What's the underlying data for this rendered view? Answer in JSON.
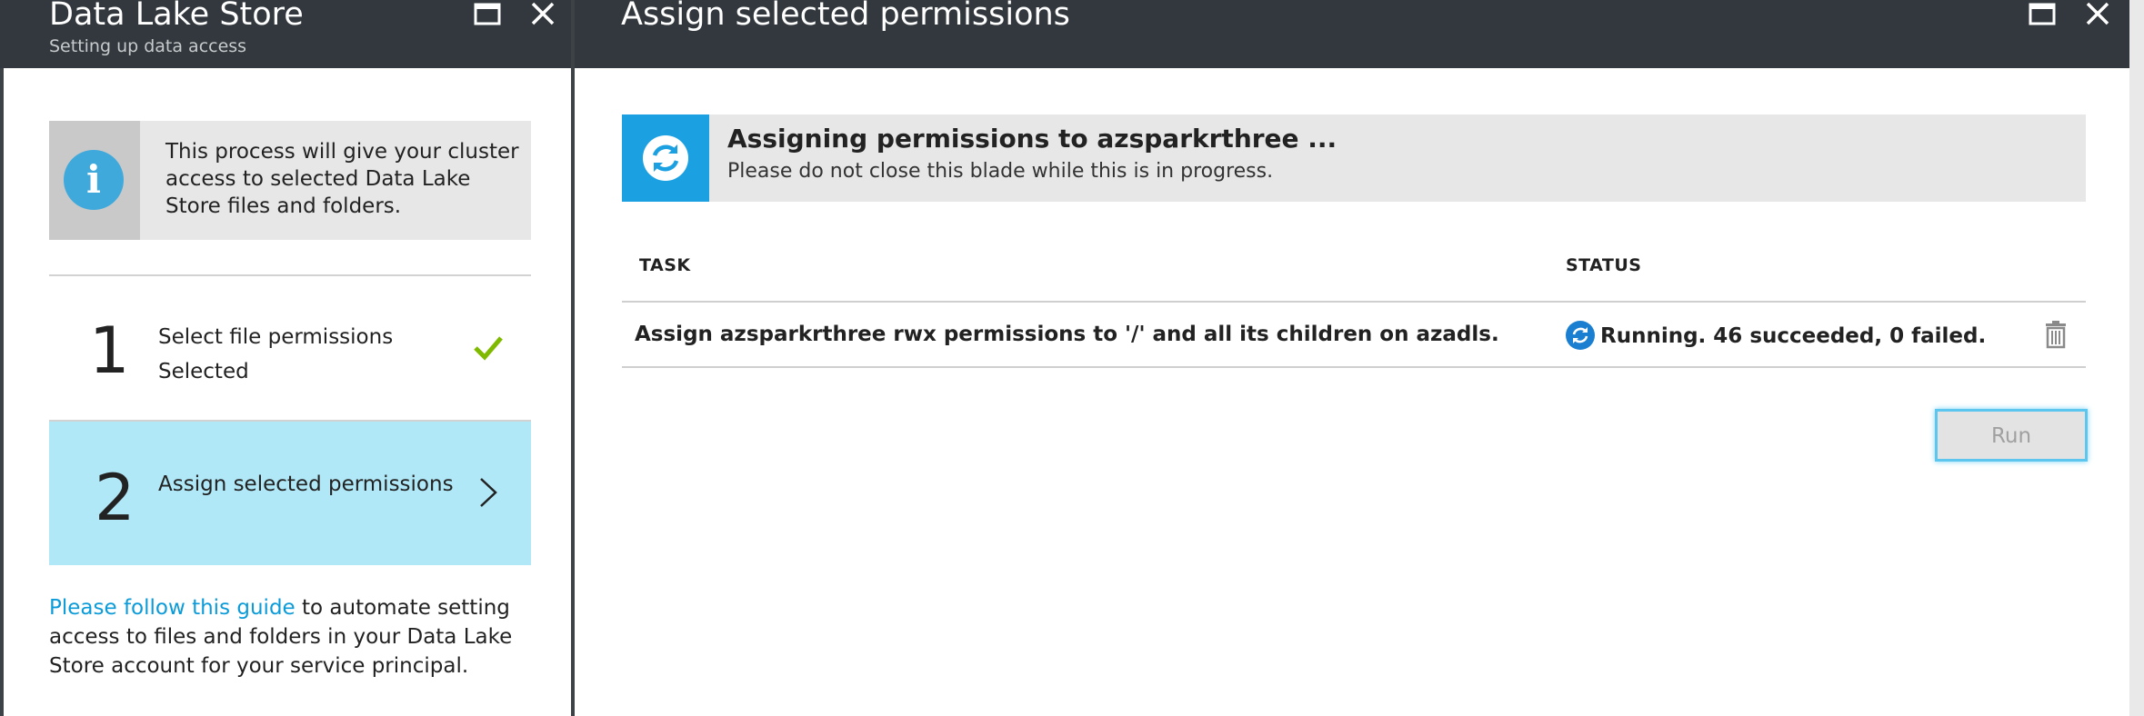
{
  "left_blade": {
    "title": "Data Lake Store",
    "subtitle": "Setting up data access",
    "info_text": "This process will give your cluster access to selected Data Lake Store files and folders.",
    "steps": [
      {
        "number": "1",
        "label": "Select file permissions",
        "status": "Selected",
        "icon": "checkmark-icon"
      },
      {
        "number": "2",
        "label": "Assign selected permissions",
        "icon": "chevron-right-icon"
      }
    ],
    "guide": {
      "link_text": "Please follow this guide",
      "rest_text": " to automate setting access to files and folders in your Data Lake Store account for your service principal."
    }
  },
  "right_blade": {
    "title": "Assign selected permissions",
    "banner": {
      "title": "Assigning permissions to azsparkrthree ...",
      "subtitle": "Please do not close this blade while this is in progress.",
      "icon": "refresh-icon"
    },
    "table": {
      "columns": [
        "TASK",
        "STATUS"
      ],
      "rows": [
        {
          "task": "Assign azsparkrthree rwx permissions to '/' and all its children on azadls.",
          "status": "Running. 46 succeeded, 0 failed."
        }
      ]
    },
    "run_label": "Run"
  },
  "colors": {
    "header_bg": "#32383d",
    "accent_blue": "#1ba1e2",
    "selected_step_bg": "#b1e8f7",
    "link": "#0b9bd8",
    "check_green": "#7fba00"
  }
}
